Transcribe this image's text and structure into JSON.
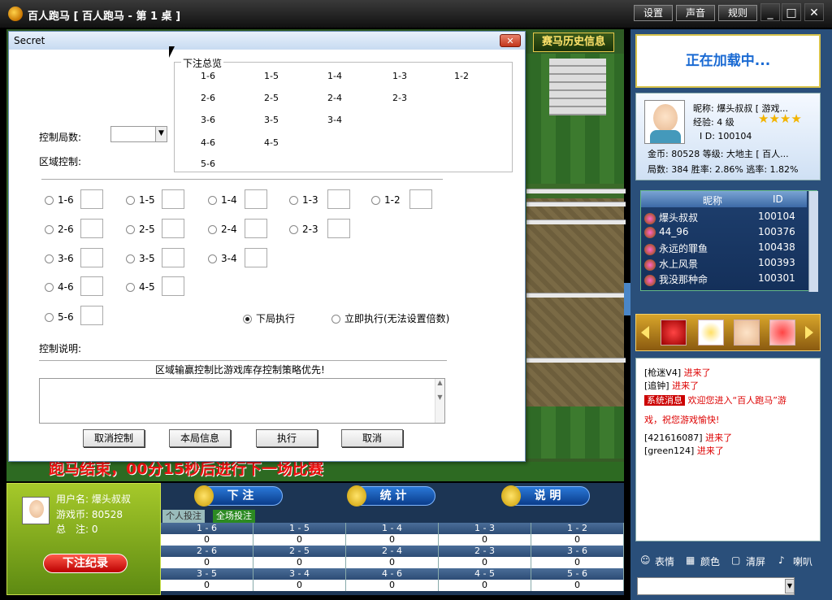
{
  "window": {
    "title": "百人跑马 [ 百人跑马 - 第 1 桌 ]",
    "settings": "设置",
    "sound": "声音",
    "rules": "规则",
    "minimize": "_",
    "maximize": "□",
    "close": "✕"
  },
  "game": {
    "history_button": "赛马历史信息",
    "countdown": "跑马结束，00分15秒后进行下一场比赛"
  },
  "dialog": {
    "title": "Secret",
    "close": "✕",
    "summary_label": "下注总览",
    "summary": [
      "1-6",
      "1-5",
      "1-4",
      "1-3",
      "1-2",
      "2-6",
      "2-5",
      "2-4",
      "2-3",
      "3-6",
      "3-5",
      "3-4",
      "4-6",
      "4-5",
      "5-6"
    ],
    "rounds_label": "控制局数:",
    "rounds_value": "",
    "area_label": "区域控制:",
    "area_options": [
      [
        "1-6",
        "1-5",
        "1-4",
        "1-3",
        "1-2"
      ],
      [
        "2-6",
        "2-5",
        "2-4",
        "2-3"
      ],
      [
        "3-6",
        "3-5",
        "3-4"
      ],
      [
        "4-6",
        "4-5"
      ],
      [
        "5-6"
      ]
    ],
    "exec_next": "下局执行",
    "exec_now": "立即执行(无法设置倍数)",
    "desc_label": "控制说明:",
    "desc_text": "区域输赢控制比游戏库存控制策略优先!",
    "buttons": {
      "cancel_control": "取消控制",
      "round_info": "本局信息",
      "execute": "执行",
      "cancel": "取消"
    }
  },
  "right": {
    "loading": "正在加载中...",
    "user": {
      "nick": "昵称: 爆头叔叔 [ 游戏...",
      "exp": "经验: 4 级",
      "id": "I D: 100104",
      "coins": "金币: 80528 等级: 大地主 [ 百人...",
      "stats": "局数: 384 胜率: 2.86% 逃率: 1.82%"
    },
    "list_head": {
      "nick": "昵称",
      "id": "ID"
    },
    "players": [
      {
        "name": "爆头叔叔",
        "id": "100104"
      },
      {
        "name": "44_96",
        "id": "100376"
      },
      {
        "name": "永远的罪鱼",
        "id": "100438"
      },
      {
        "name": "水上风景",
        "id": "100393"
      },
      {
        "name": "我没那种命",
        "id": "100301"
      }
    ],
    "chat": [
      {
        "name": "[枪迷V4]",
        "msg": "进来了"
      },
      {
        "name": "[追钟]",
        "msg": "进来了"
      },
      {
        "name": "[421616087]",
        "msg": "进来了"
      },
      {
        "name": "[green124]",
        "msg": "进来了"
      }
    ],
    "system_tag": "系统消息",
    "system_msg": "欢迎您进入“百人跑马”游",
    "system_msg2": "戏，祝您游戏愉快!",
    "tools": {
      "emote": "表情",
      "color": "颜色",
      "clear": "清屏",
      "speaker": "喇叭"
    }
  },
  "bottom": {
    "username": "用户名: 爆头叔叔",
    "coins": "游戏币: 80528",
    "total": "总　注: 0",
    "bet_record": "下注纪录",
    "tabs": [
      "下 注",
      "统 计",
      "说 明"
    ],
    "subtabs": [
      "个人投注",
      "全场投注"
    ],
    "rows": [
      {
        "labels": [
          "1 - 6",
          "1 - 5",
          "1 - 4",
          "1 - 3",
          "1 - 2"
        ],
        "values": [
          "0",
          "0",
          "0",
          "0",
          "0"
        ]
      },
      {
        "labels": [
          "2 - 6",
          "2 - 5",
          "2 - 4",
          "2 - 3",
          "3 - 6"
        ],
        "values": [
          "0",
          "0",
          "0",
          "0",
          "0"
        ]
      },
      {
        "labels": [
          "3 - 5",
          "3 - 4",
          "4 - 6",
          "4 - 5",
          "5 - 6"
        ],
        "values": [
          "0",
          "0",
          "0",
          "0",
          "0"
        ]
      }
    ]
  }
}
